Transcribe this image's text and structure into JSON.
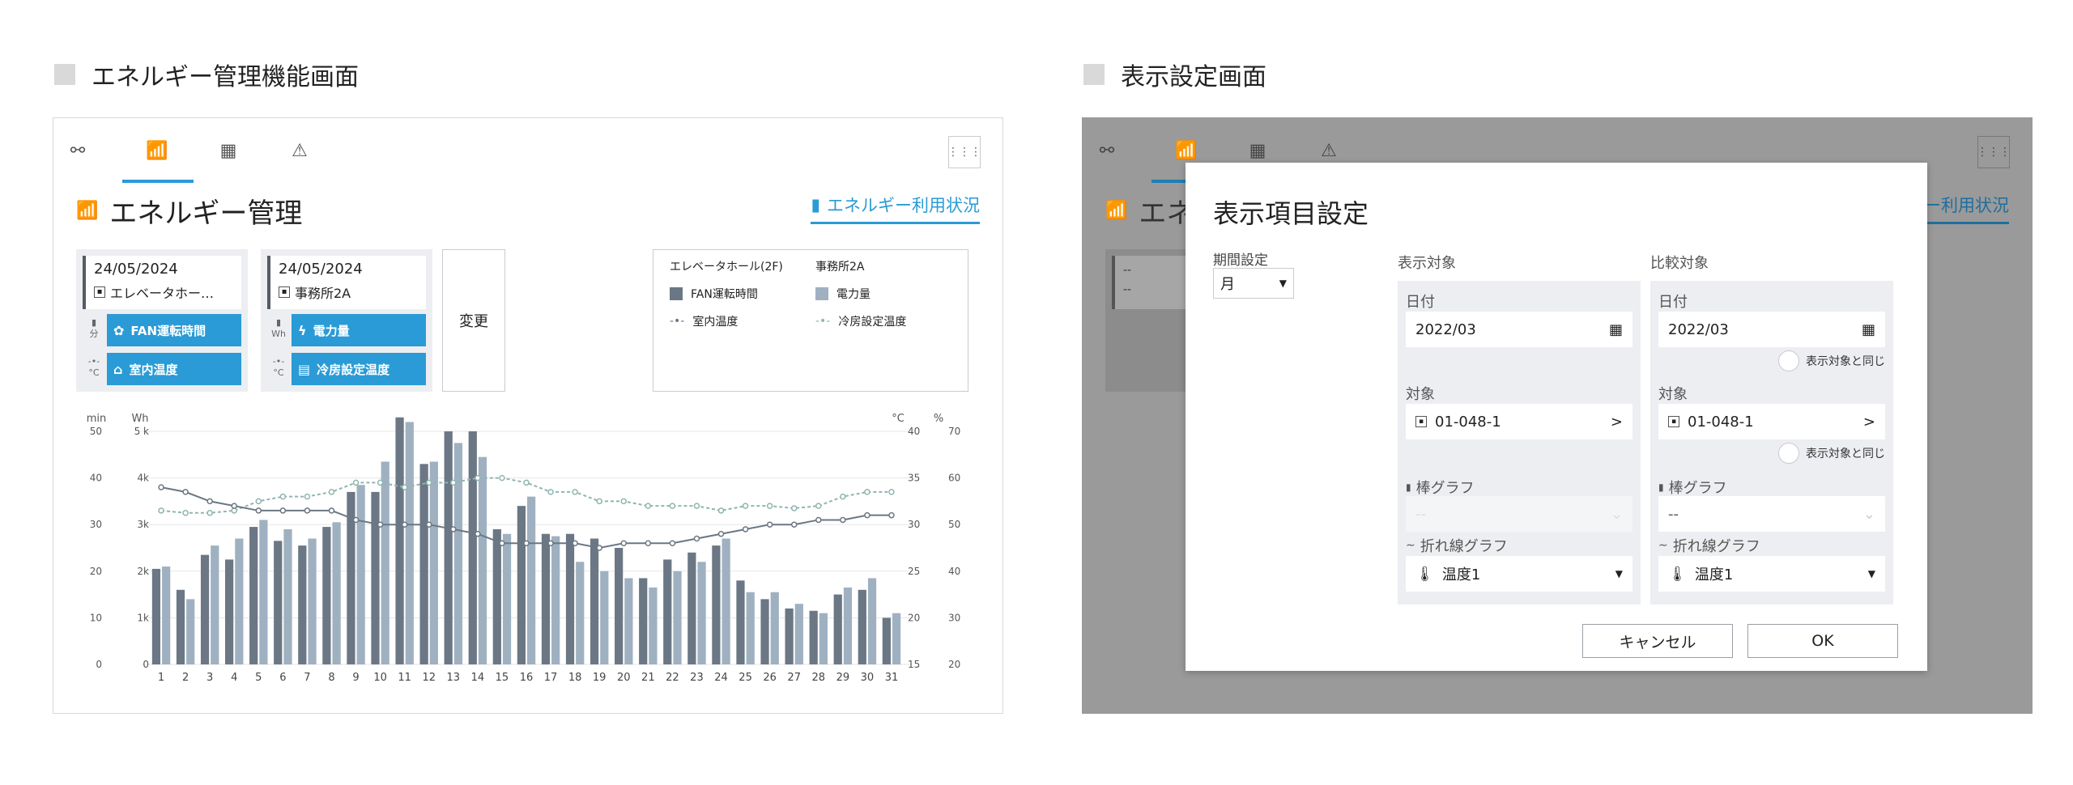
{
  "sections": {
    "left_title": "エネルギー管理機能画面",
    "right_title": "表示設定画面"
  },
  "tabs": [
    {
      "icon": "binoculars-icon",
      "glyph": "⚯"
    },
    {
      "icon": "chart-icon",
      "glyph": "📶"
    },
    {
      "icon": "calendar-icon",
      "glyph": "▦"
    },
    {
      "icon": "warning-icon",
      "glyph": "⚠"
    }
  ],
  "menu_glyph": "⋮⋮⋮",
  "page": {
    "title": "エネルギー管理",
    "energy_link": "エネルギー利用状況"
  },
  "cards": [
    {
      "date": "24/05/2024",
      "location": "エレベータホー…",
      "rows": [
        {
          "unit": "分",
          "label": "FAN運転時間",
          "icon": "fan-icon"
        },
        {
          "unit": "°C",
          "label": "室内温度",
          "icon": "home-icon"
        }
      ]
    },
    {
      "date": "24/05/2024",
      "location": "事務所2A",
      "rows": [
        {
          "unit": "Wh",
          "label": "電力量",
          "icon": "bolt-icon"
        },
        {
          "unit": "°C",
          "label": "冷房設定温度",
          "icon": "aircon-icon"
        }
      ]
    }
  ],
  "change_button": "変更",
  "legend": {
    "group1": "エレベータホール(2F)",
    "group2": "事務所2A",
    "items": [
      "FAN運転時間",
      "電力量",
      "室内温度",
      "冷房設定温度"
    ]
  },
  "colors": {
    "accent": "#2a9bd6",
    "bar_dark": "#6b7784",
    "bar_light": "#9fb1c1",
    "line_dark": "#6b7784",
    "line_light": "#8fb5b0"
  },
  "chart_data": {
    "type": "bar",
    "axis_units": {
      "left1": "min",
      "left2": "Wh",
      "right1": "°C",
      "right2": "%"
    },
    "left1_ticks": [
      "50",
      "40",
      "30",
      "20",
      "10",
      "0"
    ],
    "left2_ticks": [
      "5 k",
      "4k",
      "3k",
      "2k",
      "1k",
      "0"
    ],
    "right1_ticks": [
      "40",
      "35",
      "30",
      "25",
      "20",
      "15"
    ],
    "right2_ticks": [
      "70",
      "60",
      "50",
      "40",
      "30",
      "20"
    ],
    "categories": [
      "1",
      "2",
      "3",
      "4",
      "5",
      "6",
      "7",
      "8",
      "9",
      "10",
      "11",
      "12",
      "13",
      "14",
      "15",
      "16",
      "17",
      "18",
      "19",
      "20",
      "21",
      "22",
      "23",
      "24",
      "25",
      "26",
      "27",
      "28",
      "29",
      "30",
      "31"
    ],
    "series": [
      {
        "name": "FAN運転時間",
        "type": "bar",
        "axis": "min",
        "values": [
          20.5,
          16,
          23.5,
          22.5,
          29.5,
          26.5,
          25.5,
          29.5,
          37,
          37,
          53,
          43,
          50,
          50,
          29,
          34,
          28,
          28,
          27,
          25,
          18.5,
          22.5,
          24,
          25.5,
          18,
          14,
          12,
          11.5,
          15,
          16,
          10
        ]
      },
      {
        "name": "電力量",
        "type": "bar",
        "axis": "Wh",
        "values": [
          2100,
          1400,
          2550,
          2700,
          3100,
          2900,
          2700,
          3050,
          3850,
          4350,
          5200,
          4350,
          4750,
          4450,
          2800,
          3600,
          2750,
          2200,
          2000,
          1850,
          1650,
          2000,
          2200,
          2700,
          1550,
          1550,
          1300,
          1100,
          1650,
          1850,
          1100
        ]
      },
      {
        "name": "室内温度",
        "type": "line",
        "axis": "°C",
        "values": [
          34,
          33.5,
          32.5,
          32,
          31.5,
          31.5,
          31.5,
          31.5,
          30.5,
          30,
          30,
          30,
          29.5,
          29,
          28,
          28,
          28,
          28,
          27.5,
          28,
          28,
          28,
          28.5,
          29,
          29.5,
          30,
          30,
          30.5,
          30.5,
          31,
          31
        ]
      },
      {
        "name": "冷房設定温度",
        "type": "line",
        "axis": "%",
        "values": [
          53,
          52.5,
          52.5,
          53,
          55,
          56,
          56,
          57,
          59,
          59,
          58,
          59,
          59,
          60,
          60,
          59,
          57,
          57,
          55,
          55,
          54,
          54,
          54,
          53,
          54,
          54,
          53.5,
          54,
          56,
          57,
          57
        ]
      }
    ]
  },
  "dialog": {
    "title": "表示項目設定",
    "period_label": "期間設定",
    "period_value": "月",
    "target_label": "表示対象",
    "compare_label": "比較対象",
    "date_label": "日付",
    "date_value": "2022/03",
    "object_label": "対象",
    "object_value": "01-048-1",
    "same_label": "表示対象と同じ",
    "bar_label": "棒グラフ",
    "bar_target_value": "--",
    "bar_compare_value": "--",
    "line_label": "折れ線グラフ",
    "line_value": "温度1",
    "cancel": "キャンセル",
    "ok": "OK"
  },
  "ghost_card": {
    "line1": "--",
    "line2": "--"
  }
}
